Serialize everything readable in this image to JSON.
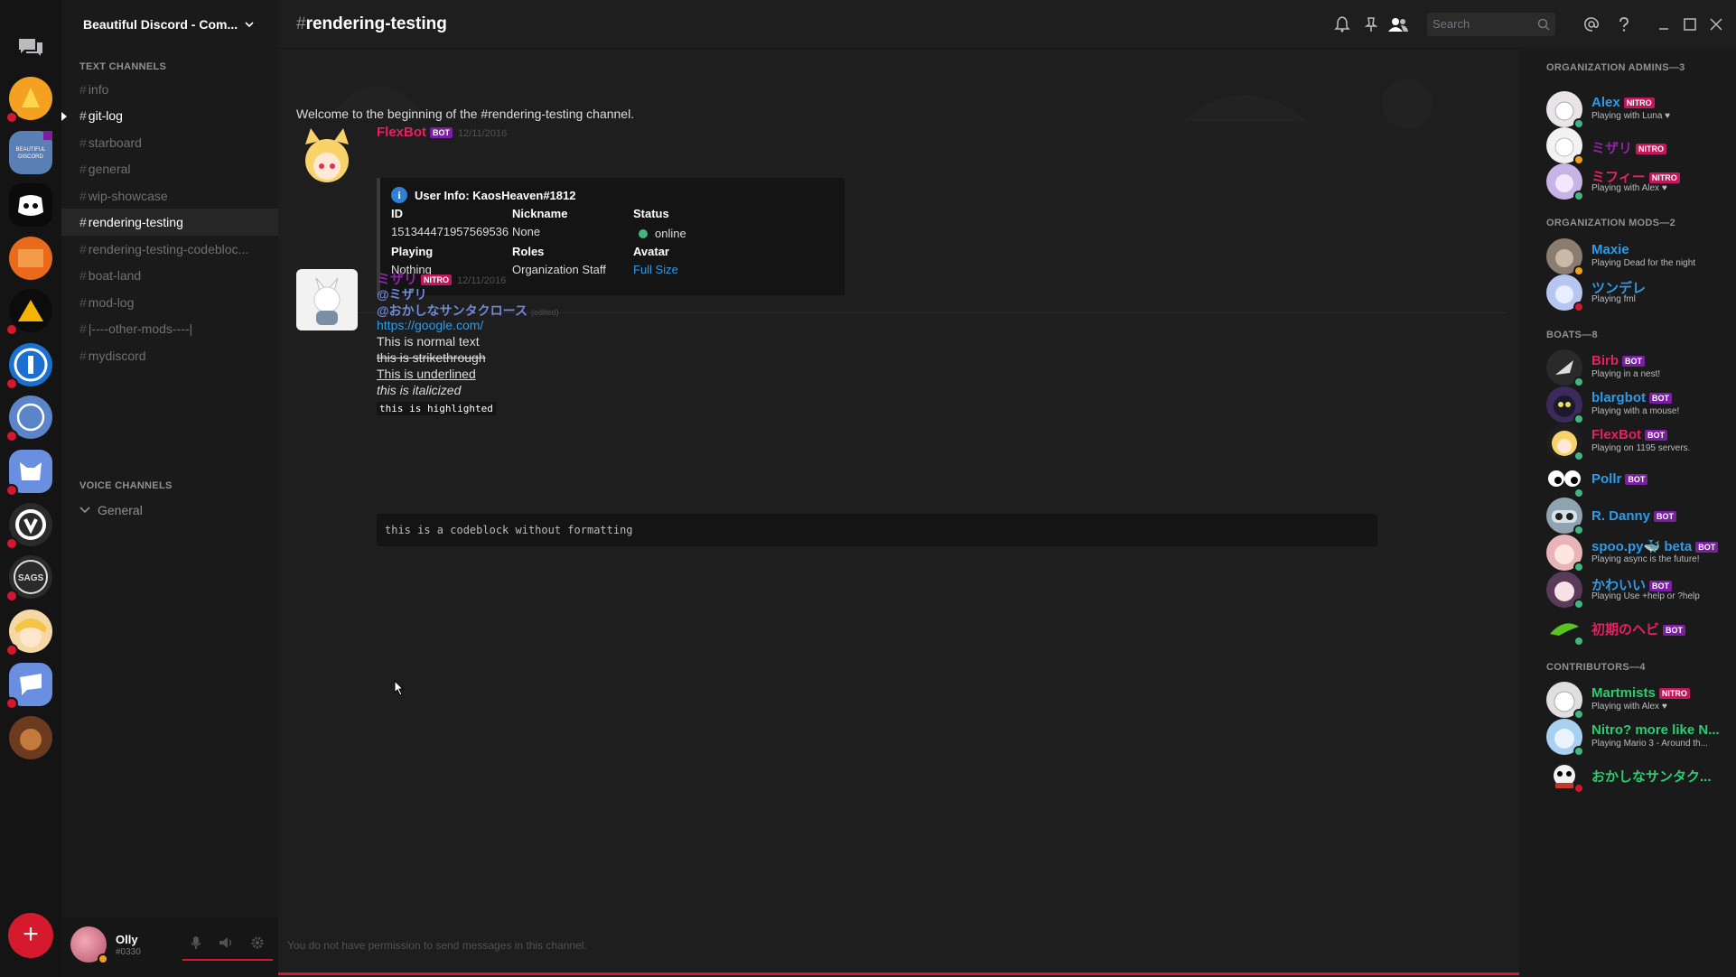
{
  "guild": {
    "name": "Beautiful Discord - Com..."
  },
  "channel_title": "rendering-testing",
  "search": {
    "placeholder": "Search"
  },
  "sidebar": {
    "text_header": "TEXT CHANNELS",
    "voice_header": "VOICE CHANNELS",
    "channels": [
      {
        "name": "info",
        "state": "normal"
      },
      {
        "name": "git-log",
        "state": "unread"
      },
      {
        "name": "starboard",
        "state": "normal"
      },
      {
        "name": "general",
        "state": "normal"
      },
      {
        "name": "wip-showcase",
        "state": "normal"
      },
      {
        "name": "rendering-testing",
        "state": "active"
      },
      {
        "name": "rendering-testing-codebloc...",
        "state": "normal"
      },
      {
        "name": "boat-land",
        "state": "normal"
      },
      {
        "name": "mod-log",
        "state": "normal"
      },
      {
        "name": "|----other-mods----|",
        "state": "normal"
      },
      {
        "name": "mydiscord",
        "state": "normal"
      }
    ],
    "voice_channels": [
      {
        "name": "General"
      }
    ]
  },
  "user": {
    "name": "Olly",
    "tag": "#0330"
  },
  "chat": {
    "welcome": "Welcome to the beginning of the #rendering-testing channel.",
    "messages": [
      {
        "author": "FlexBot",
        "badge": "BOT",
        "time": "12/11/2016",
        "author_color": "#e91e63",
        "embed": {
          "title": "User Info: KaosHeaven#1812",
          "fields": [
            {
              "name": "ID",
              "value": "151344471957569536"
            },
            {
              "name": "Nickname",
              "value": "None"
            },
            {
              "name": "Status",
              "value": "online"
            },
            {
              "name": "Playing",
              "value": "Nothing"
            },
            {
              "name": "Roles",
              "value": "Organization Staff"
            },
            {
              "name": "Avatar",
              "value": "Full Size"
            }
          ]
        }
      },
      {
        "author": "ミザリ",
        "badge": "NITRO",
        "time": "12/11/2016",
        "author_color": "#8e24aa",
        "lines": {
          "mention1": "@ミザリ",
          "mention2": "@おかしなサンタクロース",
          "edited": "(edited)",
          "link": "https://google.com/",
          "normal": "This is normal text",
          "strike": "this is strikethrough",
          "underline": "This is underlined",
          "italic": "this is italicized",
          "highlight": "this is highlighted",
          "codeblock": "this is a codeblock without formatting"
        }
      }
    ],
    "no_permission": "You do not have permission to send messages in this channel."
  },
  "members": {
    "groups": [
      {
        "title": "ORGANIZATION ADMINS—3",
        "members": [
          {
            "name": "Alex",
            "badge": "NITRO",
            "game": "Playing with Luna ♥",
            "color": "#2f9be8",
            "status": "#43b581"
          },
          {
            "name": "ミザリ",
            "badge": "NITRO",
            "game": "",
            "color": "#8e24aa",
            "status": "#f0a020"
          },
          {
            "name": "ミフィー",
            "badge": "NITRO",
            "game": "Playing with Alex ♥",
            "color": "#e91e63",
            "status": "#43b581"
          }
        ]
      },
      {
        "title": "ORGANIZATION MODS—2",
        "members": [
          {
            "name": "Maxie",
            "badge": "",
            "game": "Playing Dead for the night",
            "color": "#2f9be8",
            "status": "#f0a020"
          },
          {
            "name": "ツンデレ",
            "badge": "",
            "game": "Playing fml",
            "color": "#2f9be8",
            "status": "#d5162f"
          }
        ]
      },
      {
        "title": "BOATS—8",
        "members": [
          {
            "name": "Birb",
            "badge": "BOT",
            "game": "Playing in a nest!",
            "color": "#e91e63",
            "status": "#43b581"
          },
          {
            "name": "blargbot",
            "badge": "BOT",
            "game": "Playing with a mouse!",
            "color": "#2f9be8",
            "status": "#43b581"
          },
          {
            "name": "FlexBot",
            "badge": "BOT",
            "game": "Playing on 1195 servers.",
            "color": "#e91e63",
            "status": "#43b581"
          },
          {
            "name": "Pollr",
            "badge": "BOT",
            "game": "",
            "color": "#2f9be8",
            "status": "#43b581"
          },
          {
            "name": "R. Danny",
            "badge": "BOT",
            "game": "",
            "color": "#2f9be8",
            "status": "#43b581"
          },
          {
            "name": "spoo.py🐳 beta",
            "badge": "BOT",
            "game": "Playing async is the future!",
            "color": "#2f9be8",
            "status": "#43b581"
          },
          {
            "name": "かわいい",
            "badge": "BOT",
            "game": "Playing Use +help or ?help",
            "color": "#2f9be8",
            "status": "#43b581"
          },
          {
            "name": "初期のヘビ",
            "badge": "BOT",
            "game": "",
            "color": "#e91e63",
            "status": "#43b581"
          }
        ]
      },
      {
        "title": "CONTRIBUTORS—4",
        "members": [
          {
            "name": "Martmists",
            "badge": "NITRO",
            "game": "Playing with Alex ♥",
            "color": "#2ecc71",
            "status": "#43b581"
          },
          {
            "name": "Nitro? more like N...",
            "badge": "",
            "game": "Playing Mario 3 - Around th...",
            "color": "#2ecc71",
            "status": "#43b581"
          },
          {
            "name": "おかしなサンタク...",
            "badge": "",
            "game": "",
            "color": "#2ecc71",
            "status": "#d5162f"
          }
        ]
      }
    ]
  },
  "colors": {
    "accent_red": "#d51a2e",
    "bot_badge": "#7b1fa2",
    "nitro_badge": "#c2185b",
    "online": "#43b581"
  }
}
